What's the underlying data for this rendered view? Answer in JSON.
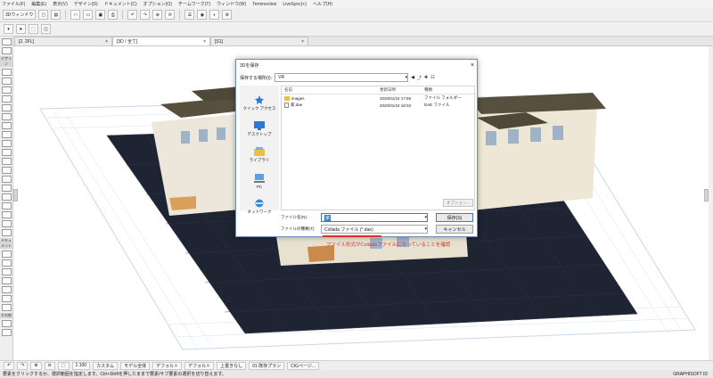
{
  "menu": [
    "ファイル(F)",
    "編集(E)",
    "表示(V)",
    "デザイン(D)",
    "ドキュメント(C)",
    "オプション(O)",
    "チームワーク(T)",
    "ウィンドウ(W)",
    "Termnection",
    "LiveSync(+)",
    "ヘルプ(H)"
  ],
  "toolbar": {
    "window3d_label": "3Dウィンドウ"
  },
  "tabs": [
    {
      "label": "[2. 2FL]",
      "active": false
    },
    {
      "label": "[3D / 全て]",
      "active": true
    },
    {
      "label": "[S1]",
      "active": false
    }
  ],
  "toolbox": {
    "header1": "デザイン",
    "header2": "ドキュメント",
    "header3": "その他"
  },
  "dialog": {
    "title": "3Dを保存",
    "location_label": "保存する場所(I):",
    "location_value": "VR",
    "places": [
      "クイック アクセス",
      "デスクトップ",
      "ライブラリ",
      "PC",
      "ネットワーク"
    ],
    "columns": [
      "名前",
      "更新日時",
      "種類"
    ],
    "files": [
      {
        "name": "images",
        "date": "2020/01/24 17:59",
        "type": "ファイル フォルダー",
        "kind": "folder"
      },
      {
        "name": "家.dae",
        "date": "2020/01/24 18:03",
        "type": "DAE ファイル",
        "kind": "file"
      }
    ],
    "options_label": "オプション...",
    "filename_label": "ファイル名(N):",
    "filename_value": "家",
    "filetype_label": "ファイルの種類(T):",
    "filetype_value": "Collada ファイル (*.dae)",
    "save_label": "保存(S)",
    "cancel_label": "キャンセル"
  },
  "annotation": "ファイル形式がColladaファイルになっていることを確認",
  "status": {
    "zoom": "1:100",
    "custom": "カスタム",
    "model": "モデル全体",
    "default1": "デフォルト",
    "default2": "デフォルト",
    "upper": "上書きなし",
    "plan": "01 既存プラン",
    "cig": "CIGページ...",
    "msg": "要素をクリックするか、選択範囲を指定します。Ctrl+Shiftを押したままで要素/サブ要素の選択を切り替えます。",
    "logo": "GRAPHISOFT ID"
  },
  "colors": {
    "accent": "#3c78c8",
    "annot": "#e02b2b",
    "ground": "#1f2433",
    "roof": "#57503f",
    "grid": "#c8d7ee"
  }
}
